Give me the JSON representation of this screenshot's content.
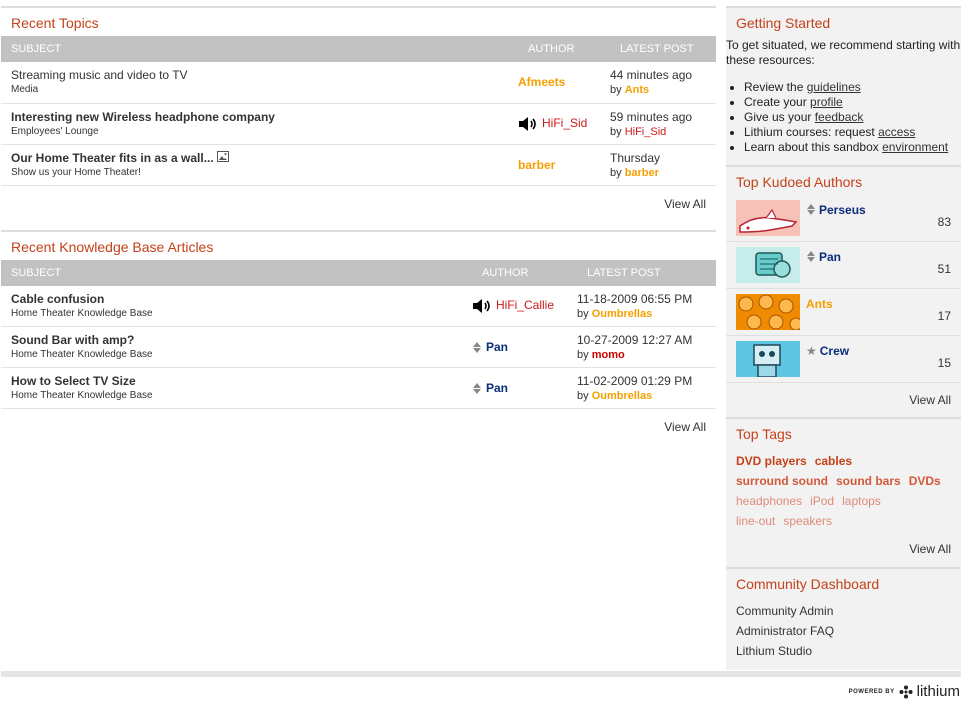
{
  "recent_topics": {
    "title": "Recent Topics",
    "columns": [
      "SUBJECT",
      "AUTHOR",
      "LATEST POST"
    ],
    "rows": [
      {
        "subject": "Streaming music and video to TV",
        "board": "Media",
        "author": "Afmeets",
        "time": "44 minutes ago",
        "by": "by",
        "by_user": "Ants"
      },
      {
        "subject": "Interesting new Wireless headphone company",
        "board": "Employees' Lounge",
        "author": "HiFi_Sid",
        "time": "59 minutes ago",
        "by": "by",
        "by_user": "HiFi_Sid"
      },
      {
        "subject": "Our Home Theater fits in as a wall...",
        "board": "Show us your Home Theater!",
        "author": "barber",
        "time": "Thursday",
        "by": "by",
        "by_user": "barber"
      }
    ],
    "view_all": "View All"
  },
  "recent_kb": {
    "title": "Recent Knowledge Base Articles",
    "columns": [
      "SUBJECT",
      "AUTHOR",
      "LATEST POST"
    ],
    "rows": [
      {
        "subject": "Cable confusion",
        "board": "Home Theater Knowledge Base",
        "author": "HiFi_Callie",
        "time": "11-18-2009 06:55 PM",
        "by": "by",
        "by_user": "Oumbrellas"
      },
      {
        "subject": "Sound Bar with amp?",
        "board": "Home Theater Knowledge Base",
        "author": "Pan",
        "time": "10-27-2009 12:27 AM",
        "by": "by",
        "by_user": "momo"
      },
      {
        "subject": "How to Select TV Size",
        "board": "Home Theater Knowledge Base",
        "author": "Pan",
        "time": "11-02-2009 01:29 PM",
        "by": "by",
        "by_user": "Oumbrellas"
      }
    ],
    "view_all": "View All"
  },
  "getting_started": {
    "title": "Getting Started",
    "intro": "To get situated, we recommend starting with these resources:",
    "items": [
      {
        "text": "Review the ",
        "link": "guidelines"
      },
      {
        "text": "Create your ",
        "link": "profile"
      },
      {
        "text": "Give us your ",
        "link": "feedback"
      },
      {
        "text": "Lithium courses: request ",
        "link": "access"
      },
      {
        "text": "Learn about this sandbox ",
        "link": "environment"
      }
    ]
  },
  "top_kudoed": {
    "title": "Top Kudoed Authors",
    "authors": [
      {
        "name": "Perseus",
        "count": "83",
        "color": "#0a2c7a"
      },
      {
        "name": "Pan",
        "count": "51",
        "color": "#0a2c7a"
      },
      {
        "name": "Ants",
        "count": "17",
        "color": "#f5a000"
      },
      {
        "name": "Crew",
        "count": "15",
        "color": "#0a2c7a"
      }
    ],
    "view_all": "View All"
  },
  "top_tags": {
    "title": "Top Tags",
    "tags": [
      {
        "label": "DVD players",
        "weight": 1
      },
      {
        "label": "cables",
        "weight": 1
      },
      {
        "label": "surround sound",
        "weight": 2
      },
      {
        "label": "sound bars",
        "weight": 2
      },
      {
        "label": "DVDs",
        "weight": 2
      },
      {
        "label": "headphones",
        "weight": 3
      },
      {
        "label": "iPod",
        "weight": 3
      },
      {
        "label": "laptops",
        "weight": 3
      },
      {
        "label": "line-out",
        "weight": 3
      },
      {
        "label": "speakers",
        "weight": 3
      }
    ],
    "view_all": "View All"
  },
  "dashboard": {
    "title": "Community Dashboard",
    "items": [
      "Community Admin",
      "Administrator FAQ",
      "Lithium Studio"
    ]
  },
  "footer": {
    "powered_by": "POWERED BY",
    "brand": "lithium"
  },
  "colors": {
    "accent": "#c4421a",
    "header_bg": "#c2c2c2",
    "username_orange": "#f5a000",
    "username_red": "#cc1a1a",
    "username_navy": "#0a2c7a"
  }
}
